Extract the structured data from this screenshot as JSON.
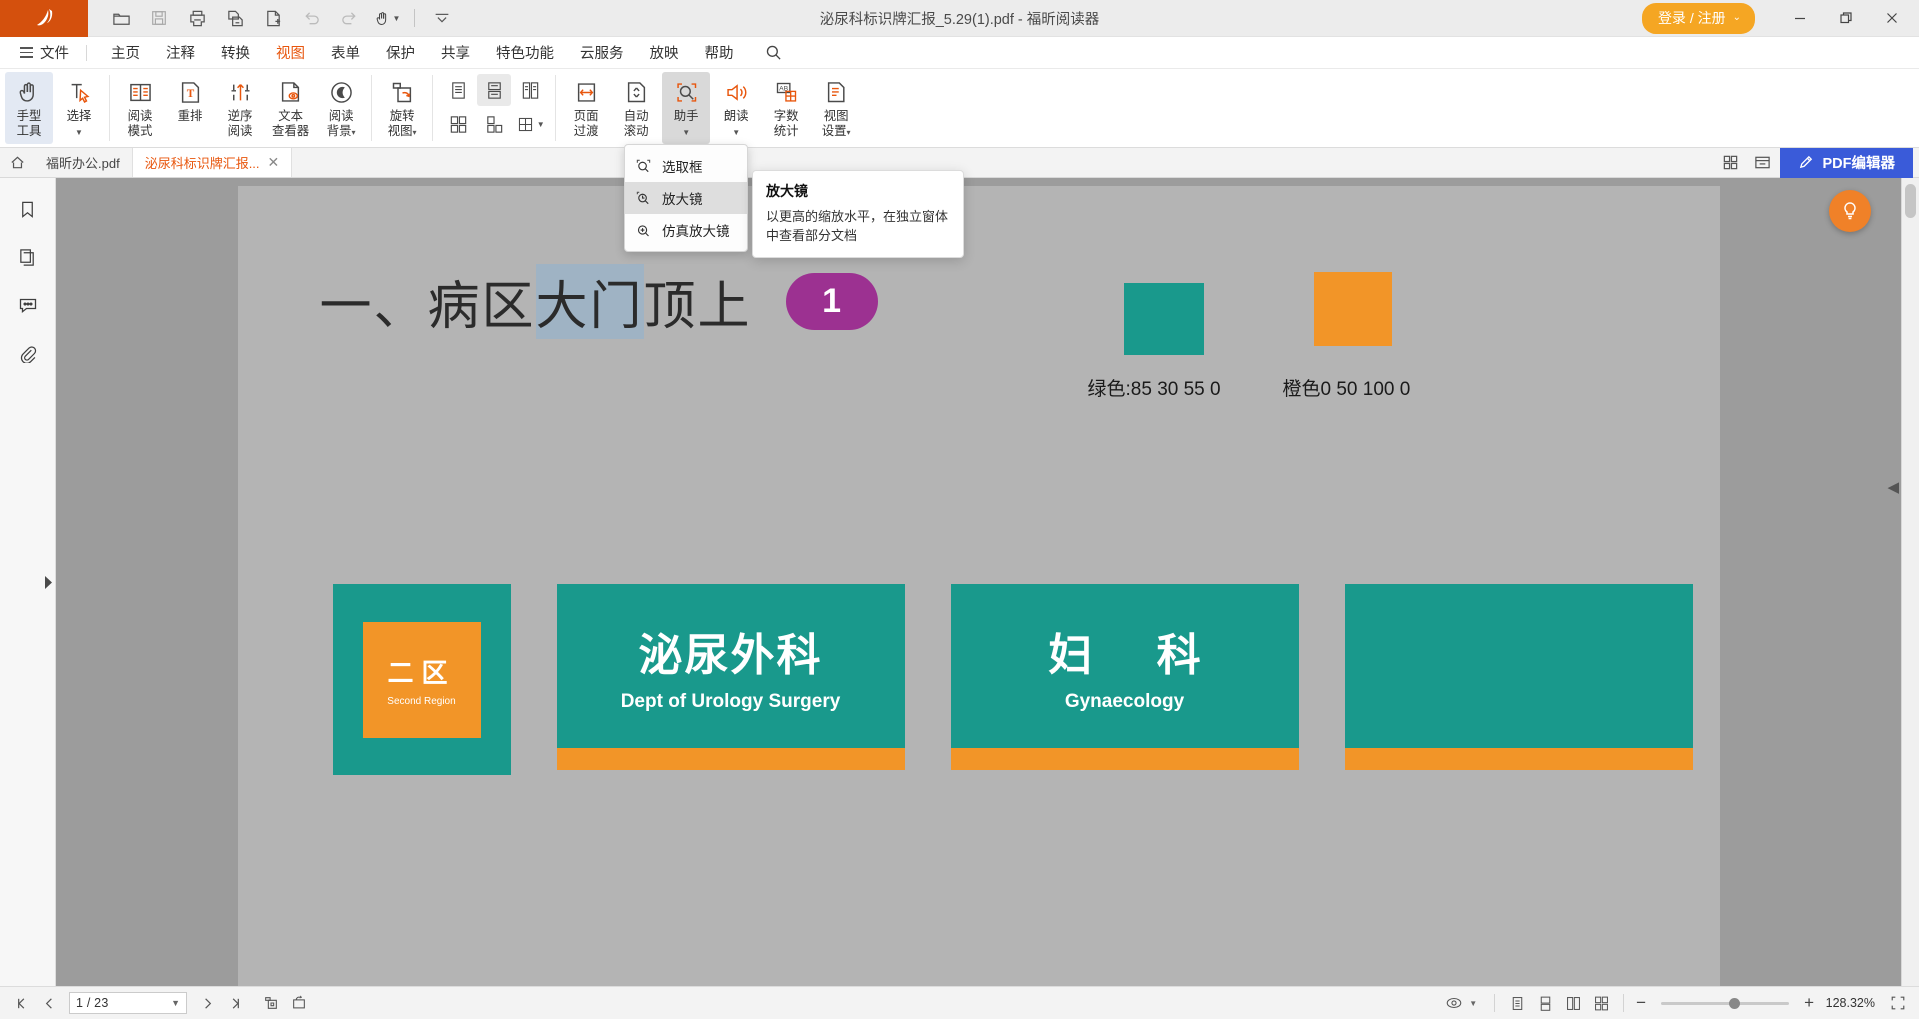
{
  "window": {
    "title": "泌尿科标识牌汇报_5.29(1).pdf - 福昕阅读器",
    "logo_icon": "foxit-logo-icon",
    "login_label": "登录 / 注册",
    "login_caret": "⌄",
    "minimize_label": "—",
    "restore_label": "❐",
    "close_label": "✕",
    "accent_color": "#d4500d",
    "login_color": "#f5a623"
  },
  "quick_access": [
    {
      "name": "open-icon",
      "tip": "打开"
    },
    {
      "name": "save-icon",
      "tip": "保存"
    },
    {
      "name": "print-icon",
      "tip": "打印"
    },
    {
      "name": "copy-page-icon",
      "tip": "复制"
    },
    {
      "name": "new-page-icon",
      "tip": "新建"
    },
    {
      "name": "undo-icon",
      "tip": "撤销"
    },
    {
      "name": "redo-icon",
      "tip": "恢复"
    },
    {
      "name": "hand-tool-icon",
      "tip": "手型工具"
    },
    {
      "name": "more-chevron-icon",
      "tip": "更多"
    }
  ],
  "menubar": {
    "file_label": "文件",
    "items": [
      {
        "label": "主页",
        "active": false
      },
      {
        "label": "注释",
        "active": false
      },
      {
        "label": "转换",
        "active": false
      },
      {
        "label": "视图",
        "active": true
      },
      {
        "label": "表单",
        "active": false
      },
      {
        "label": "保护",
        "active": false
      },
      {
        "label": "共享",
        "active": false
      },
      {
        "label": "特色功能",
        "active": false
      },
      {
        "label": "云服务",
        "active": false
      },
      {
        "label": "放映",
        "active": false
      },
      {
        "label": "帮助",
        "active": false
      }
    ],
    "search_icon": "search-icon"
  },
  "ribbon": {
    "buttons": [
      {
        "icon": "hand-tool-icon",
        "line1": "手型",
        "line2": "工具",
        "state": "selected",
        "dropdown": false
      },
      {
        "icon": "select-text-icon",
        "line1": "选择",
        "line2": "",
        "state": "normal",
        "dropdown": true
      },
      {
        "icon": "read-mode-icon",
        "line1": "阅读",
        "line2": "模式",
        "state": "normal",
        "dropdown": false
      },
      {
        "icon": "reflow-icon",
        "line1": "重排",
        "line2": "",
        "state": "normal",
        "dropdown": false
      },
      {
        "icon": "reverse-read-icon",
        "line1": "逆序",
        "line2": "阅读",
        "state": "normal",
        "dropdown": false
      },
      {
        "icon": "text-viewer-icon",
        "line1": "文本",
        "line2": "查看器",
        "state": "normal",
        "dropdown": false
      },
      {
        "icon": "read-background-icon",
        "line1": "阅读",
        "line2": "背景",
        "state": "normal",
        "dropdown": true
      },
      {
        "icon": "rotate-view-icon",
        "line1": "旋转",
        "line2": "视图",
        "state": "normal",
        "dropdown": true
      }
    ],
    "layout_grid": [
      {
        "icon": "single-page-icon",
        "state": "normal",
        "row": 1
      },
      {
        "icon": "continuous-page-icon",
        "state": "selected",
        "row": 1
      },
      {
        "icon": "two-page-icon",
        "state": "normal",
        "row": 1
      },
      {
        "icon": "two-page-cont-icon",
        "state": "normal",
        "row": 2
      },
      {
        "icon": "separate-cover-icon",
        "state": "normal",
        "row": 2
      },
      {
        "icon": "split-view-icon",
        "state": "normal",
        "row": 2,
        "dropdown": true
      }
    ],
    "buttons2": [
      {
        "icon": "page-transition-icon",
        "line1": "页面",
        "line2": "过渡",
        "state": "normal",
        "dropdown": false
      },
      {
        "icon": "auto-scroll-icon",
        "line1": "自动",
        "line2": "滚动",
        "state": "normal",
        "dropdown": false
      },
      {
        "icon": "assistant-icon",
        "line1": "助手",
        "line2": "",
        "state": "open",
        "dropdown": true
      },
      {
        "icon": "read-aloud-icon",
        "line1": "朗读",
        "line2": "",
        "state": "normal",
        "dropdown": true
      },
      {
        "icon": "word-count-icon",
        "line1": "字数",
        "line2": "统计",
        "state": "normal",
        "dropdown": false
      },
      {
        "icon": "view-settings-icon",
        "line1": "视图",
        "line2": "设置",
        "state": "normal",
        "dropdown": true
      }
    ]
  },
  "dropdown": {
    "items": [
      {
        "icon": "marquee-zoom-icon",
        "label": "选取框",
        "highlighted": false
      },
      {
        "icon": "magnifier-icon",
        "label": "放大镜",
        "highlighted": true
      },
      {
        "icon": "loupe-icon",
        "label": "仿真放大镜",
        "highlighted": false
      }
    ]
  },
  "tooltip": {
    "title": "放大镜",
    "body": "以更高的缩放水平，在独立窗体中查看部分文档"
  },
  "tabstrip": {
    "home_icon": "home-tab-icon",
    "tabs": [
      {
        "label": "福昕办公.pdf",
        "active": false,
        "closable": false
      },
      {
        "label": "泌尿科标识牌汇报...",
        "active": true,
        "closable": true,
        "close_icon": "close-icon"
      }
    ],
    "right_buttons": [
      {
        "icon": "grid-view-icon"
      },
      {
        "icon": "split-tabs-icon"
      }
    ],
    "pdf_editor_label": "PDF编辑器",
    "pdf_editor_icon": "pdf-editor-icon",
    "pdf_editor_color": "#3a5bd9"
  },
  "leftbar": {
    "items": [
      {
        "icon": "bookmark-icon",
        "name": "bookmarks-panel"
      },
      {
        "icon": "pages-icon",
        "name": "pages-panel"
      },
      {
        "icon": "comments-icon",
        "name": "comments-panel"
      },
      {
        "icon": "attachments-icon",
        "name": "attachments-panel"
      }
    ],
    "expand_icon": "expand-panel-icon"
  },
  "document": {
    "heading_prefix": "一、病区",
    "heading_highlight": "大门",
    "heading_suffix": "顶上",
    "badge_number": "1",
    "badge_color": "#9c3191",
    "green_swatch_color": "#19998c",
    "orange_swatch_color": "#f29528",
    "green_label": "绿色:85 30 55 0",
    "orange_label": "橙色0 50 100 0",
    "signs": [
      {
        "type": "square",
        "cn": "二区",
        "en": "Second Region"
      },
      {
        "type": "wide",
        "cn": "泌尿外科",
        "en": "Dept of Urology Surgery",
        "spaced": false
      },
      {
        "type": "wide",
        "cn": "妇  科",
        "en": "Gynaecology",
        "spaced": true
      },
      {
        "type": "plain",
        "cn": "",
        "en": ""
      }
    ],
    "helper_icon": "lightbulb-icon",
    "collapse_icon": "collapse-right-icon"
  },
  "statusbar": {
    "first_page_icon": "first-page-icon",
    "prev_page_icon": "prev-page-icon",
    "page_value": "1 / 23",
    "page_dropdown_icon": "chevron-down-icon",
    "next_page_icon": "next-page-icon",
    "last_page_icon": "last-page-icon",
    "snapshot_icon": "snapshot-icon",
    "rotate_icon": "rotate-page-icon",
    "view_mode_icon": "view-mode-icon",
    "right_buttons": [
      {
        "icon": "single-page-status-icon",
        "selected": false
      },
      {
        "icon": "continuous-status-icon",
        "selected": false
      },
      {
        "icon": "facing-status-icon",
        "selected": false
      },
      {
        "icon": "facing-cont-status-icon",
        "selected": false
      }
    ],
    "zoom_out_label": "−",
    "zoom_in_label": "+",
    "zoom_value": "128.32%",
    "fullscreen_icon": "fullscreen-icon"
  }
}
